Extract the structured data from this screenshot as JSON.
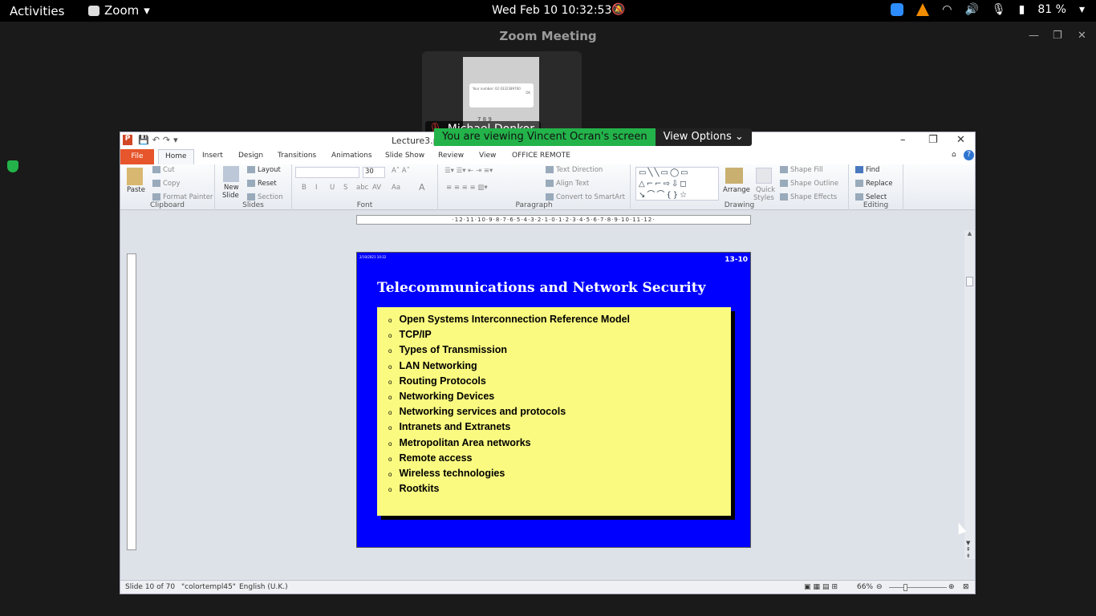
{
  "topbar": {
    "activities": "Activities",
    "app_name": "Zoom",
    "clock": "Wed Feb 10  10:32:53",
    "battery": "81 %"
  },
  "zoom": {
    "window_title": "Zoom Meeting",
    "participant_name": "Michael Donkor",
    "share_banner": "You are viewing Vincent Ocran's screen",
    "view_options": "View Options",
    "thumb_text": "Your number: 02 0332389760",
    "thumb_button": "OK",
    "thumb_keys": "7   8   9"
  },
  "ppt": {
    "filename": "Lecture3.pp",
    "tabs": [
      "File",
      "Home",
      "Insert",
      "Design",
      "Transitions",
      "Animations",
      "Slide Show",
      "Review",
      "View",
      "OFFICE REMOTE"
    ],
    "clipboard": {
      "paste": "Paste",
      "cut": "Cut",
      "copy": "Copy",
      "format_painter": "Format Painter",
      "group": "Clipboard"
    },
    "slides": {
      "new_slide": "New",
      "new_slide2": "Slide",
      "layout": "Layout",
      "reset": "Reset",
      "section": "Section",
      "group": "Slides"
    },
    "font": {
      "size": "30",
      "group": "Font",
      "bold": "B",
      "italic": "I",
      "underline": "U",
      "strike": "S",
      "abc": "abc",
      "av": "AV",
      "aa": "Aa",
      "a": "A"
    },
    "paragraph": {
      "text_direction": "Text Direction",
      "align_text": "Align Text",
      "convert_smartart": "Convert to SmartArt",
      "group": "Paragraph"
    },
    "drawing": {
      "arrange": "Arrange",
      "quick_styles": "Quick",
      "quick_styles2": "Styles",
      "shape_fill": "Shape Fill",
      "shape_outline": "Shape Outline",
      "shape_effects": "Shape Effects",
      "group": "Drawing"
    },
    "editing": {
      "find": "Find",
      "replace": "Replace",
      "select": "Select",
      "group": "Editing"
    },
    "ruler_text": "·12·11·10·9·8·7·6·5·4·3·2·1·0·1·2·3·4·5·6·7·8·9·10·11·12·"
  },
  "slide": {
    "header_small": "2/10/2021   10:22",
    "number": "13-10",
    "title": "Telecommunications and Network  Security",
    "bullets": [
      "Open Systems Interconnection Reference Model",
      "TCP/IP",
      "Types of Transmission",
      "LAN Networking",
      "Routing Protocols",
      "Networking Devices",
      "Networking services and protocols",
      "Intranets and Extranets",
      "Metropolitan Area networks",
      "Remote access",
      "Wireless technologies",
      "Rootkits"
    ]
  },
  "status": {
    "slide_info": "Slide 10 of 70",
    "theme": "\"colortempl45\"",
    "language": "English (U.K.)",
    "zoom": "66%"
  }
}
